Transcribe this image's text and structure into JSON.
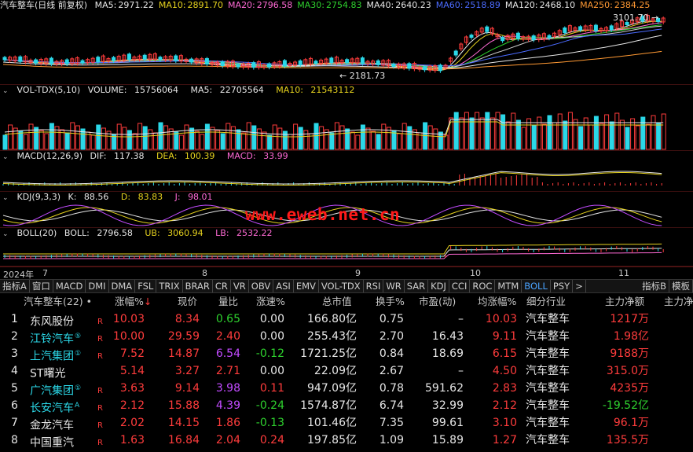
{
  "kline": {
    "title": "汽车整车(日线 前复权)",
    "ma": [
      {
        "label": "MA5:",
        "value": "2971.22",
        "color": "#e6e6e6"
      },
      {
        "label": "MA10:",
        "value": "2891.70",
        "color": "#e6d21e"
      },
      {
        "label": "MA20:",
        "value": "2796.58",
        "color": "#ff6ad5"
      },
      {
        "label": "MA30:",
        "value": "2754.83",
        "color": "#2ed12e"
      },
      {
        "label": "MA40:",
        "value": "2640.23",
        "color": "#e6e6e6"
      },
      {
        "label": "MA60:",
        "value": "2518.89",
        "color": "#4b6bff"
      },
      {
        "label": "MA120:",
        "value": "2468.10",
        "color": "#e6e6e6"
      },
      {
        "label": "MA250:",
        "value": "2384.25",
        "color": "#ff9933"
      }
    ],
    "high_label": "3101.70",
    "low_label": "2181.73"
  },
  "volume": {
    "title": "VOL-TDX(5,10)",
    "vol_label": "VOLUME:",
    "vol_value": "15756064",
    "ma5_label": "MA5:",
    "ma5_value": "22705564",
    "ma10_label": "MA10:",
    "ma10_value": "21543112"
  },
  "macd": {
    "title": "MACD(12,26,9)",
    "dif_label": "DIF:",
    "dif_value": "117.38",
    "dea_label": "DEA:",
    "dea_value": "100.39",
    "macd_label": "MACD:",
    "macd_value": "33.99"
  },
  "kdj": {
    "title": "KDJ(9,3,3)",
    "k_label": "K:",
    "k_value": "88.56",
    "d_label": "D:",
    "d_value": "83.83",
    "j_label": "J:",
    "j_value": "98.01",
    "watermark": "www.eweb.net.cn"
  },
  "boll": {
    "title": "BOLL(20)",
    "boll_label": "BOLL:",
    "boll_value": "2796.58",
    "ub_label": "UB:",
    "ub_value": "3060.94",
    "lb_label": "LB:",
    "lb_value": "2532.22"
  },
  "date_axis": {
    "year": "2024年",
    "months": [
      "7",
      "8",
      "9",
      "10",
      "11"
    ]
  },
  "tabs": [
    "指标A",
    "窗口",
    "MACD",
    "DMI",
    "DMA",
    "FSL",
    "TRIX",
    "BRAR",
    "CR",
    "VR",
    "OBV",
    "ASI",
    "EMV",
    "VOL-TDX",
    "RSI",
    "WR",
    "SAR",
    "KDJ",
    "CCI",
    "ROC",
    "MTM",
    "BOLL",
    "PSY",
    ">",
    "指标B",
    "模板"
  ],
  "active_tab": "BOLL",
  "table": {
    "headers": {
      "name": "汽车整车(22) •",
      "change": "涨幅%",
      "price": "现价",
      "vol_ratio": "量比",
      "speed": "涨速%",
      "mcap": "总市值",
      "turnover": "换手%",
      "pe": "市盈(动)",
      "avg_change": "均涨幅%",
      "industry": "细分行业",
      "net": "主力净额",
      "net2": "主力净"
    },
    "rows": [
      {
        "idx": "1",
        "name": "东风股份",
        "sup": "",
        "name_color": "white",
        "r": "R",
        "change": "10.03",
        "price": "8.34",
        "vol_ratio": "0.65",
        "vr_color": "#2ed12e",
        "speed": "0.00",
        "sp_color": "#e6e6e6",
        "mcap": "166.80亿",
        "turnover": "0.75",
        "pe": "–",
        "avg_change": "10.03",
        "industry": "汽车整车",
        "net": "1217万",
        "net_color": "#ff3c3c"
      },
      {
        "idx": "2",
        "name": "江铃汽车",
        "sup": "⑤",
        "name_color": "blue",
        "r": "R",
        "change": "10.00",
        "price": "29.59",
        "vol_ratio": "2.40",
        "vr_color": "#ff3c3c",
        "speed": "0.00",
        "sp_color": "#e6e6e6",
        "mcap": "255.43亿",
        "turnover": "2.70",
        "pe": "16.43",
        "avg_change": "9.11",
        "industry": "汽车整车",
        "net": "1.98亿",
        "net_color": "#ff3c3c"
      },
      {
        "idx": "3",
        "name": "上汽集团",
        "sup": "①",
        "name_color": "blue",
        "r": "R",
        "change": "7.52",
        "price": "14.87",
        "vol_ratio": "6.54",
        "vr_color": "#c24bff",
        "speed": "-0.12",
        "sp_color": "#2ed12e",
        "mcap": "1721.25亿",
        "turnover": "0.84",
        "pe": "18.69",
        "avg_change": "6.15",
        "industry": "汽车整车",
        "net": "9188万",
        "net_color": "#ff3c3c"
      },
      {
        "idx": "4",
        "name": "ST曙光",
        "sup": "",
        "name_color": "white",
        "r": "",
        "change": "5.14",
        "price": "3.27",
        "vol_ratio": "2.71",
        "vr_color": "#ff3c3c",
        "speed": "0.00",
        "sp_color": "#e6e6e6",
        "mcap": "22.09亿",
        "turnover": "2.67",
        "pe": "–",
        "avg_change": "4.50",
        "industry": "汽车整车",
        "net": "315.0万",
        "net_color": "#ff3c3c"
      },
      {
        "idx": "5",
        "name": "广汽集团",
        "sup": "①",
        "name_color": "blue",
        "r": "R",
        "change": "3.63",
        "price": "9.14",
        "vol_ratio": "3.98",
        "vr_color": "#c24bff",
        "speed": "0.11",
        "sp_color": "#ff3c3c",
        "mcap": "947.09亿",
        "turnover": "0.78",
        "pe": "591.62",
        "avg_change": "2.83",
        "industry": "汽车整车",
        "net": "4235万",
        "net_color": "#ff3c3c"
      },
      {
        "idx": "6",
        "name": "长安汽车",
        "sup": "A",
        "name_color": "blue",
        "r": "R",
        "change": "2.12",
        "price": "15.88",
        "vol_ratio": "4.39",
        "vr_color": "#c24bff",
        "speed": "-0.24",
        "sp_color": "#2ed12e",
        "mcap": "1574.87亿",
        "turnover": "6.74",
        "pe": "32.99",
        "avg_change": "2.12",
        "industry": "汽车整车",
        "net": "-19.52亿",
        "net_color": "#2ed12e"
      },
      {
        "idx": "7",
        "name": "金龙汽车",
        "sup": "",
        "name_color": "white",
        "r": "R",
        "change": "2.02",
        "price": "14.15",
        "vol_ratio": "1.86",
        "vr_color": "#ff3c3c",
        "speed": "-0.13",
        "sp_color": "#2ed12e",
        "mcap": "101.46亿",
        "turnover": "7.35",
        "pe": "99.61",
        "avg_change": "3.10",
        "industry": "汽车整车",
        "net": "96.1万",
        "net_color": "#ff3c3c"
      },
      {
        "idx": "8",
        "name": "中国重汽",
        "sup": "",
        "name_color": "white",
        "r": "R",
        "change": "1.63",
        "price": "16.84",
        "vol_ratio": "2.04",
        "vr_color": "#ff3c3c",
        "speed": "0.24",
        "sp_color": "#ff3c3c",
        "mcap": "197.85亿",
        "turnover": "1.09",
        "pe": "15.89",
        "avg_change": "1.27",
        "industry": "汽车整车",
        "net": "135.5万",
        "net_color": "#ff3c3c"
      }
    ]
  }
}
